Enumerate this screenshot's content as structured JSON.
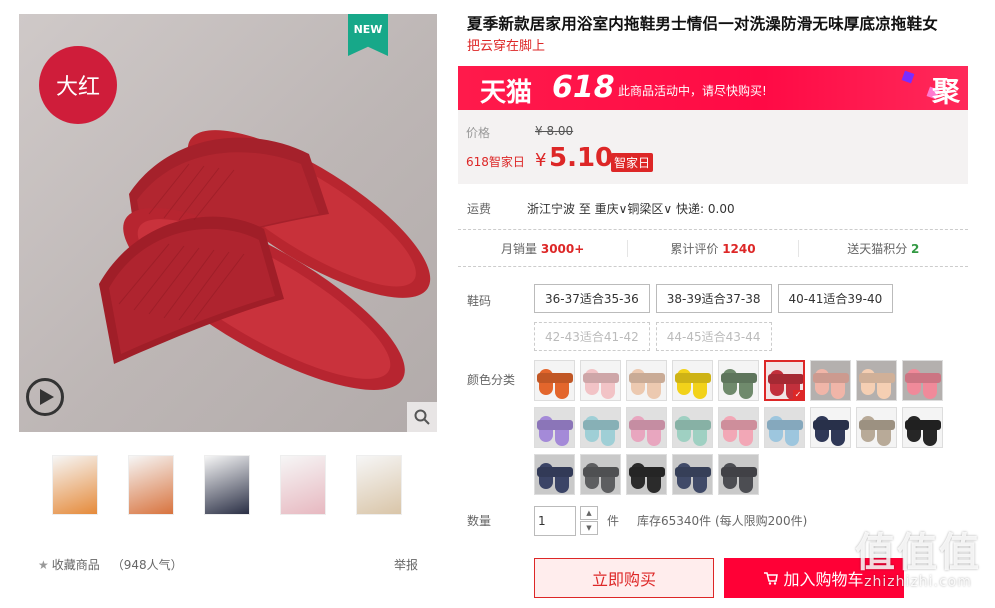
{
  "gallery": {
    "badge": "大红",
    "new_tag": "NEW",
    "thumbnails": [
      {
        "label": "thumbnail-1",
        "color": "#e58a3a"
      },
      {
        "label": "thumbnail-2",
        "color": "#d8733e"
      },
      {
        "label": "thumbnail-3",
        "color": "#2a2f45"
      },
      {
        "label": "thumbnail-4",
        "color": "#e7b8c0"
      },
      {
        "label": "thumbnail-5",
        "color": "#d9c5a8"
      }
    ]
  },
  "favorites": {
    "label": "收藏商品",
    "popularity": "（948人气）",
    "report": "举报"
  },
  "product": {
    "title": "夏季新款居家用浴室内拖鞋男士情侣一对洗澡防滑无味厚底凉拖鞋女",
    "subtitle": "把云穿在脚上"
  },
  "promo_banner": {
    "brand": "天猫",
    "event": "618",
    "text": "此商品活动中，请尽快购买!",
    "right_mark": "聚"
  },
  "price": {
    "label": "价格",
    "original": "¥ 8.00",
    "promo_label": "618智家日",
    "currency": "¥",
    "current": "5.10",
    "tag": "智家日"
  },
  "shipping": {
    "label": "运费",
    "text": "浙江宁波  至  重庆∨铜梁区∨  快递: 0.00"
  },
  "stats": [
    {
      "label": "月销量",
      "value": "3000+",
      "color": "red"
    },
    {
      "label": "累计评价",
      "value": "1240",
      "color": "red"
    },
    {
      "label": "送天猫积分",
      "value": "2",
      "color": "green"
    }
  ],
  "sizes": {
    "label": "鞋码",
    "options": [
      {
        "text": "36-37适合35-36",
        "available": true
      },
      {
        "text": "38-39适合37-38",
        "available": true
      },
      {
        "text": "40-41适合39-40",
        "available": true
      },
      {
        "text": "42-43适合41-42",
        "available": false
      },
      {
        "text": "44-45适合43-44",
        "available": false
      }
    ]
  },
  "colors": {
    "label": "颜色分类",
    "swatches": [
      {
        "color": "#e3662c",
        "bg": "#f4f4f4",
        "selected": false
      },
      {
        "color": "#f2c3c6",
        "bg": "#f4f4f4",
        "selected": false
      },
      {
        "color": "#ecc9b0",
        "bg": "#f4f4f4",
        "selected": false
      },
      {
        "color": "#f2d21a",
        "bg": "#f4f4f4",
        "selected": false
      },
      {
        "color": "#6f8a6c",
        "bg": "#f4f4f4",
        "selected": false
      },
      {
        "color": "#c2303c",
        "bg": "#f1e5e6",
        "selected": true
      },
      {
        "color": "#f0b5a8",
        "bg": "#b4b0ae",
        "selected": false
      },
      {
        "color": "#f5cfb3",
        "bg": "#b4b0ae",
        "selected": false
      },
      {
        "color": "#f08a9a",
        "bg": "#b4b0ae",
        "selected": false
      },
      {
        "color": "#a48ad8",
        "bg": "#e0e0e0",
        "selected": false
      },
      {
        "color": "#9fcfd6",
        "bg": "#e0e0e0",
        "selected": false
      },
      {
        "color": "#e8a6bf",
        "bg": "#e0e0e0",
        "selected": false
      },
      {
        "color": "#9fd0c2",
        "bg": "#e0e0e0",
        "selected": false
      },
      {
        "color": "#f2a7b6",
        "bg": "#e0e0e0",
        "selected": false
      },
      {
        "color": "#9dc6de",
        "bg": "#e0e0e0",
        "selected": false
      },
      {
        "color": "#2f3857",
        "bg": "#f4f4f4",
        "selected": false
      },
      {
        "color": "#b8aa98",
        "bg": "#f4f4f4",
        "selected": false
      },
      {
        "color": "#262626",
        "bg": "#f4f4f4",
        "selected": false
      },
      {
        "color": "#3b4466",
        "bg": "#c9c9c9",
        "selected": false
      },
      {
        "color": "#5d5e60",
        "bg": "#c9c9c9",
        "selected": false
      },
      {
        "color": "#2b2b2b",
        "bg": "#c9c9c9",
        "selected": false
      },
      {
        "color": "#404a68",
        "bg": "#c9c9c9",
        "selected": false
      },
      {
        "color": "#4c4d52",
        "bg": "#c9c9c9",
        "selected": false
      }
    ]
  },
  "quantity": {
    "label": "数量",
    "value": "1",
    "unit": "件",
    "stock": "库存65340件    (每人限购200件)"
  },
  "actions": {
    "buy_now": "立即购买",
    "add_to_cart": "加入购物车"
  },
  "watermark": {
    "big": "值值值",
    "small": "zhizhizhi.com"
  },
  "colors_theme": {
    "accent": "#dd2727",
    "tmall_red": "#ff0036"
  }
}
